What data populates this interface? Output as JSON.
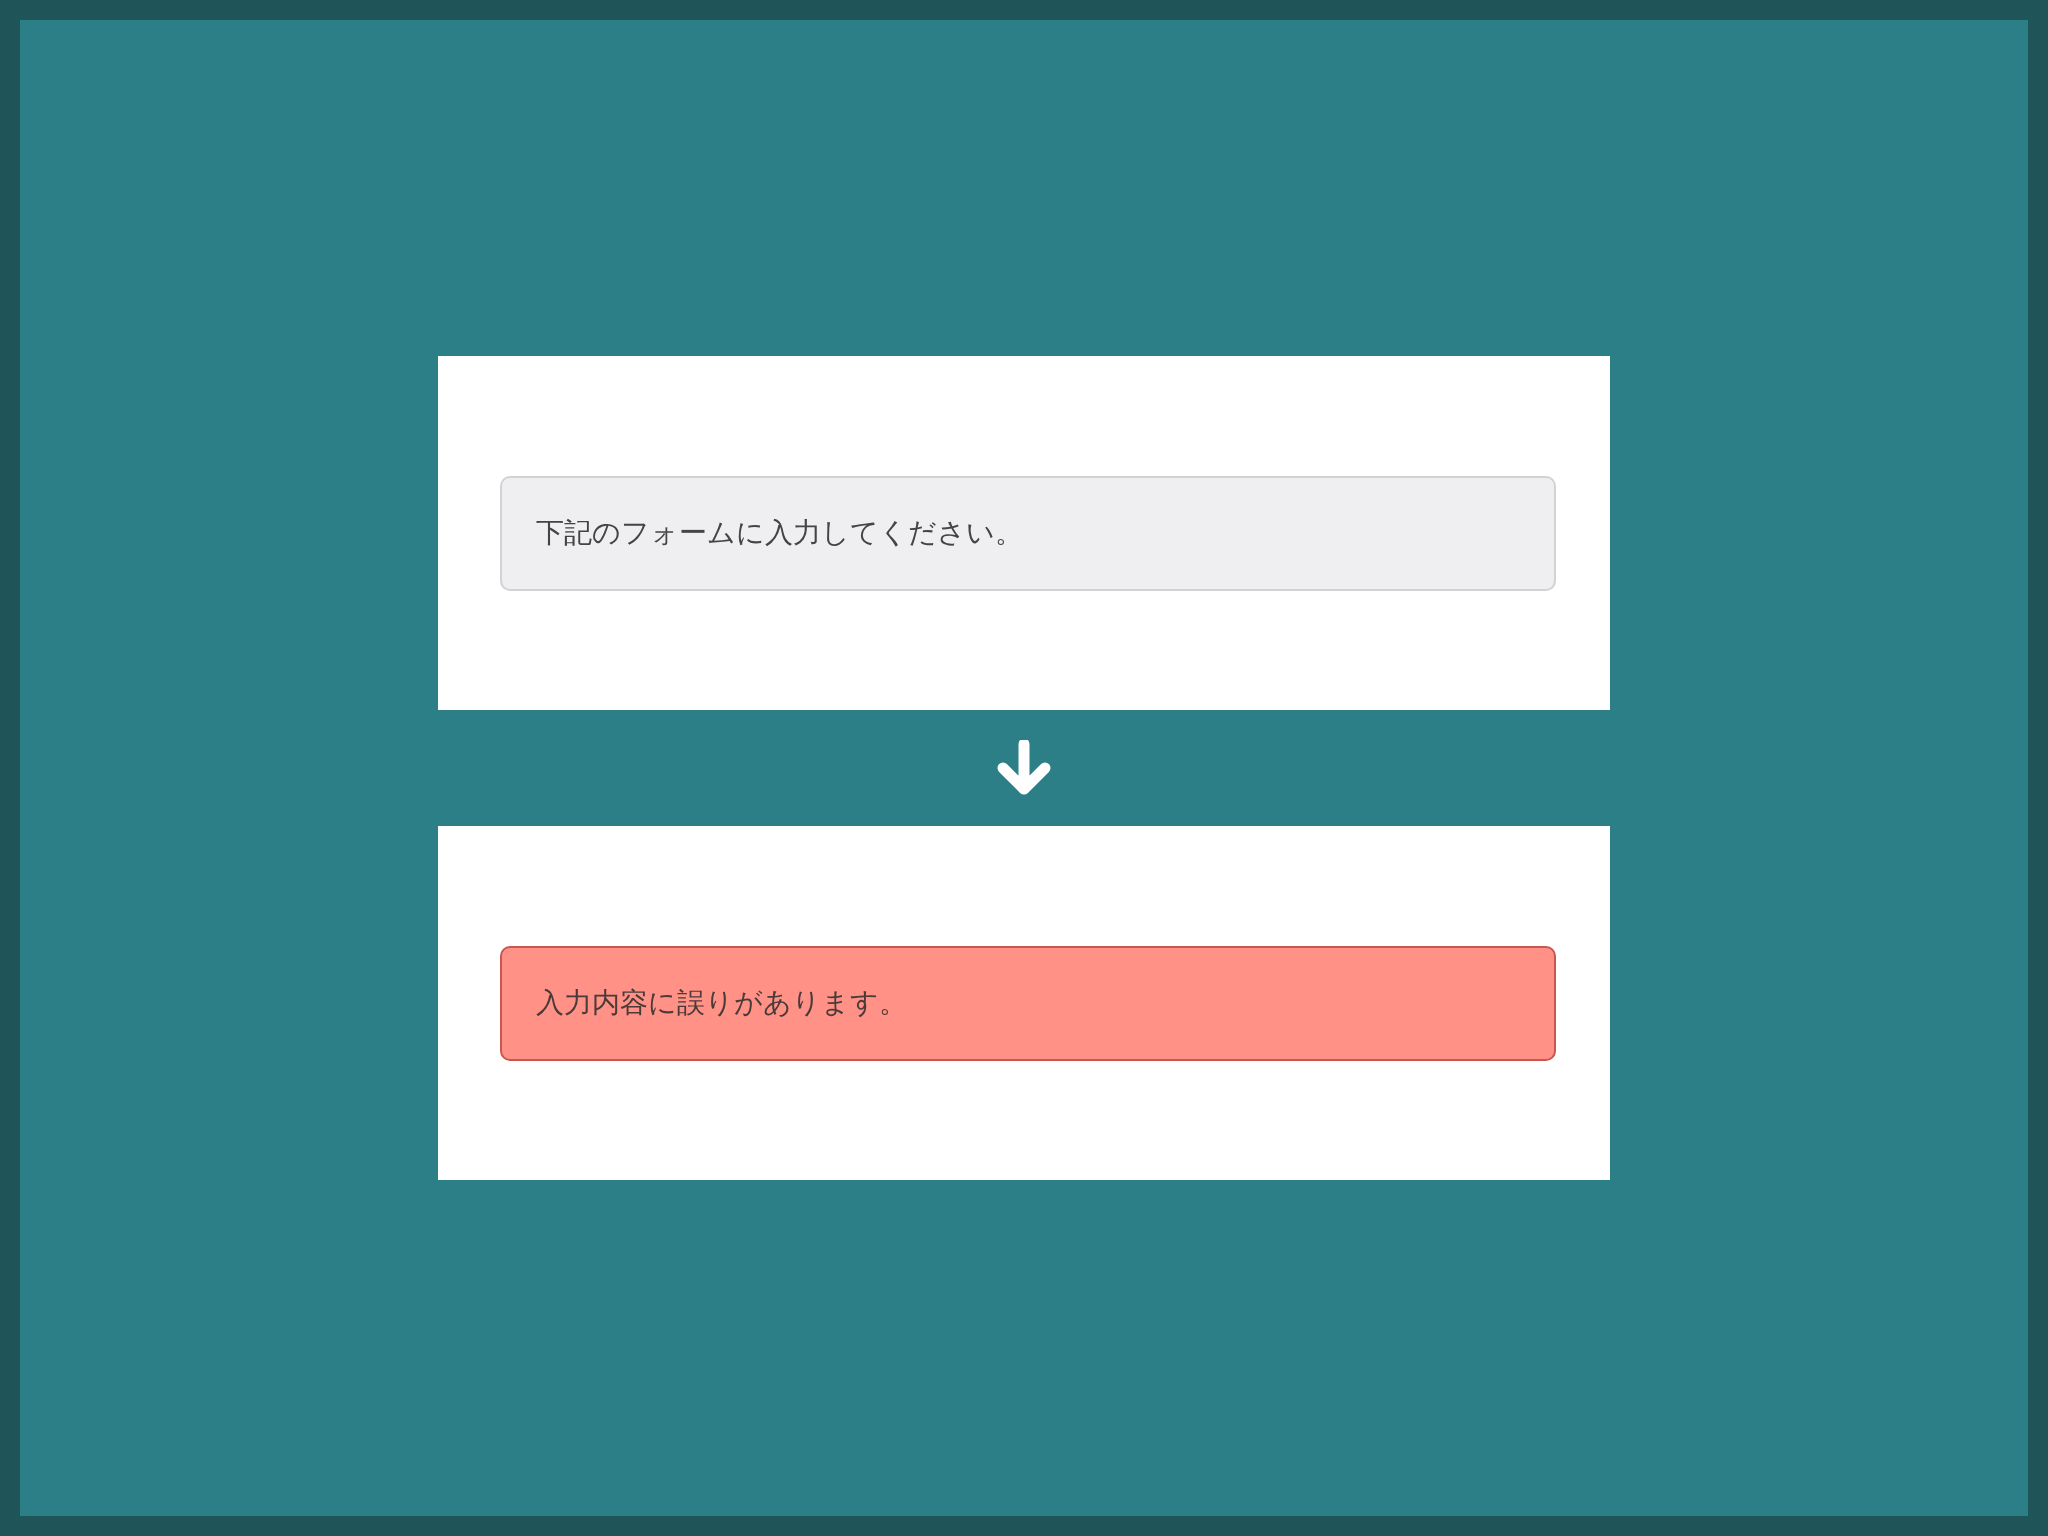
{
  "panels": [
    {
      "kind": "info",
      "message": "下記のフォームに入力してください。"
    },
    {
      "kind": "error",
      "message": "入力内容に誤りがあります。"
    }
  ]
}
